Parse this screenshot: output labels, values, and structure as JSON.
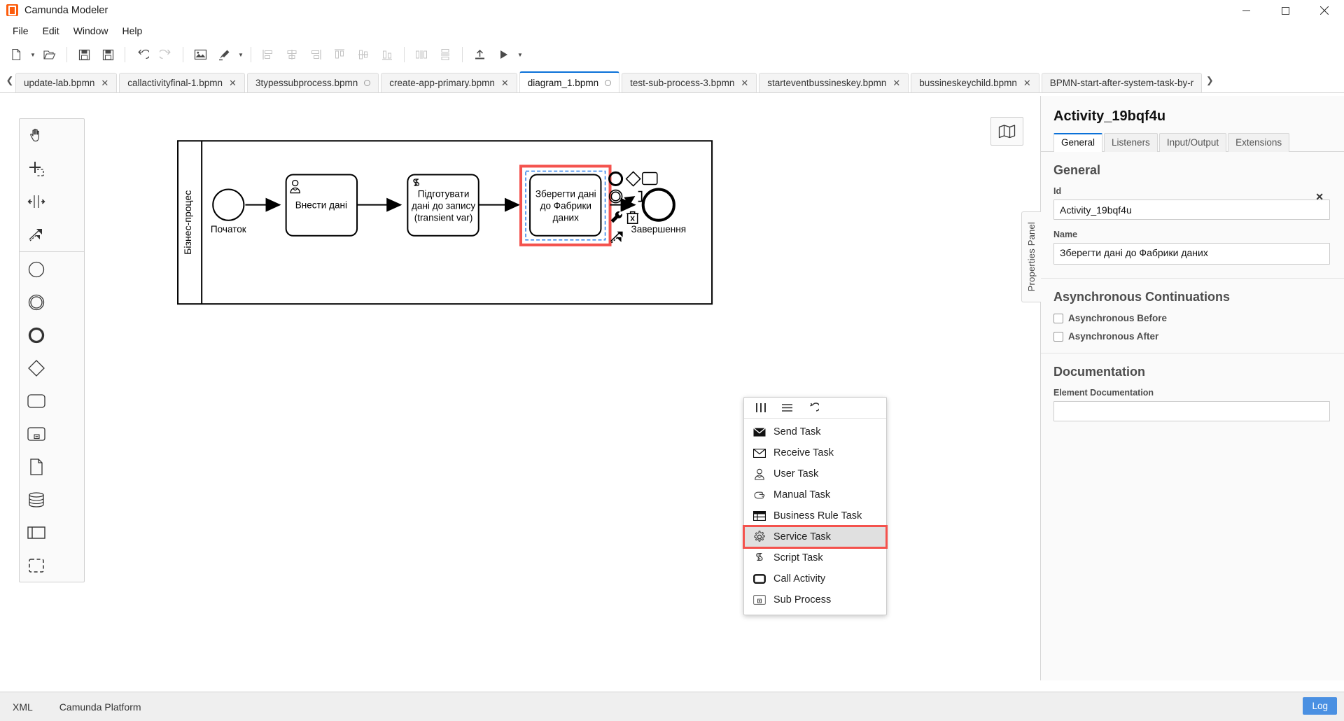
{
  "window": {
    "title": "Camunda Modeler",
    "logo_icon": "camunda-logo-icon",
    "minimize_label": "Minimize",
    "maximize_label": "Maximize",
    "close_label": "Close"
  },
  "menubar": {
    "items": [
      {
        "label": "File"
      },
      {
        "label": "Edit"
      },
      {
        "label": "Window"
      },
      {
        "label": "Help"
      }
    ]
  },
  "toolbar": {
    "buttons": [
      {
        "name": "new-file-button",
        "icon": "new-file-icon",
        "disabled": false,
        "caret": true
      },
      {
        "name": "open-file-button",
        "icon": "open-folder-icon",
        "disabled": false,
        "caret": false
      },
      {
        "name": "save-button",
        "icon": "save-icon",
        "disabled": false,
        "caret": false
      },
      {
        "name": "save-as-button",
        "icon": "save-as-icon",
        "disabled": false,
        "caret": false
      },
      {
        "name": "undo-button",
        "icon": "undo-icon",
        "disabled": false,
        "caret": false
      },
      {
        "name": "redo-button",
        "icon": "redo-icon",
        "disabled": true,
        "caret": false
      },
      {
        "name": "export-image-button",
        "icon": "image-icon",
        "disabled": false,
        "caret": false
      },
      {
        "name": "color-picker-button",
        "icon": "paintbrush-icon",
        "disabled": false,
        "caret": true
      },
      {
        "name": "align-left-button",
        "icon": "align-left-icon",
        "disabled": true,
        "caret": false
      },
      {
        "name": "align-center-button",
        "icon": "align-center-icon",
        "disabled": true,
        "caret": false
      },
      {
        "name": "align-right-button",
        "icon": "align-right-icon",
        "disabled": true,
        "caret": false
      },
      {
        "name": "align-top-button",
        "icon": "align-top-icon",
        "disabled": true,
        "caret": false
      },
      {
        "name": "align-middle-button",
        "icon": "align-middle-icon",
        "disabled": true,
        "caret": false
      },
      {
        "name": "align-bottom-button",
        "icon": "align-bottom-icon",
        "disabled": true,
        "caret": false
      },
      {
        "name": "distribute-horizontal-button",
        "icon": "distribute-horizontal-icon",
        "disabled": true,
        "caret": false
      },
      {
        "name": "distribute-vertical-button",
        "icon": "distribute-vertical-icon",
        "disabled": true,
        "caret": false
      },
      {
        "name": "deploy-button",
        "icon": "deploy-upload-icon",
        "disabled": false,
        "caret": false
      },
      {
        "name": "start-instance-button",
        "icon": "play-icon",
        "disabled": false,
        "caret": true
      }
    ]
  },
  "tabs": {
    "scroll_left_icon": "chevron-left-icon",
    "scroll_right_icon": "chevron-right-icon",
    "items": [
      {
        "label": "update-lab.bpmn",
        "active": false,
        "dirty": false
      },
      {
        "label": "callactivityfinal-1.bpmn",
        "active": false,
        "dirty": false
      },
      {
        "label": "3typessubprocess.bpmn",
        "active": false,
        "dirty": true
      },
      {
        "label": "create-app-primary.bpmn",
        "active": false,
        "dirty": false
      },
      {
        "label": "diagram_1.bpmn",
        "active": true,
        "dirty": true
      },
      {
        "label": "test-sub-process-3.bpmn",
        "active": false,
        "dirty": false
      },
      {
        "label": "starteventbussineskey.bpmn",
        "active": false,
        "dirty": false
      },
      {
        "label": "bussineskeychild.bpmn",
        "active": false,
        "dirty": false
      },
      {
        "label": "BPMN-start-after-system-task-by-r",
        "active": false,
        "dirty": false,
        "truncated": true
      }
    ]
  },
  "palette": {
    "tools": [
      {
        "name": "hand-tool",
        "icon": "hand-icon"
      },
      {
        "name": "lasso-tool",
        "icon": "lasso-select-icon"
      },
      {
        "name": "space-tool",
        "icon": "space-tool-icon"
      },
      {
        "name": "connect-tool",
        "icon": "connect-arrow-icon"
      }
    ],
    "elements": [
      {
        "name": "create-start-event",
        "icon": "start-event-circle-icon"
      },
      {
        "name": "create-intermediate-event",
        "icon": "intermediate-event-double-circle-icon"
      },
      {
        "name": "create-end-event",
        "icon": "end-event-thick-circle-icon"
      },
      {
        "name": "create-gateway",
        "icon": "gateway-diamond-icon"
      },
      {
        "name": "create-task",
        "icon": "task-rounded-rect-icon"
      },
      {
        "name": "create-expanded-subprocess",
        "icon": "subprocess-expanded-icon"
      },
      {
        "name": "create-data-object",
        "icon": "data-object-icon"
      },
      {
        "name": "create-data-store",
        "icon": "data-store-cylinder-icon"
      },
      {
        "name": "create-participant",
        "icon": "participant-pool-icon"
      },
      {
        "name": "create-group",
        "icon": "group-dashed-icon"
      }
    ]
  },
  "minimap": {
    "name": "toggle-minimap-button",
    "icon": "map-icon"
  },
  "diagram": {
    "pool_label": "Бізнес-процес",
    "start_event_label": "Початок",
    "end_event_label": "Завершення",
    "tasks": [
      {
        "id": "task-1",
        "label": "Внести дані",
        "type": "user-task",
        "marker_icon": "user-task-icon"
      },
      {
        "id": "task-2",
        "label": "Підготувати дані до запису (transient var)",
        "type": "script-task",
        "marker_icon": "script-task-icon",
        "lines": [
          "Підготувати",
          "дані до запису",
          "(transient var)"
        ]
      },
      {
        "id": "task-3",
        "label": "Зберегти дані до Фабрики даних",
        "type": "task",
        "selected": true,
        "lines": [
          "Зберегти дані",
          "до Фабрики",
          "даних"
        ]
      }
    ],
    "context_pad": {
      "items": [
        {
          "name": "append-end-event",
          "icon": "end-event-icon"
        },
        {
          "name": "append-gateway",
          "icon": "gateway-icon"
        },
        {
          "name": "append-task",
          "icon": "task-icon"
        },
        {
          "name": "append-intermediate-event",
          "icon": "intermediate-event-icon"
        },
        {
          "name": "append-text-annotation",
          "icon": "text-annotation-icon"
        },
        {
          "name": "change-type",
          "icon": "wrench-icon"
        },
        {
          "name": "delete-element",
          "icon": "trash-icon"
        },
        {
          "name": "connect",
          "icon": "connect-icon"
        }
      ]
    }
  },
  "replace_menu": {
    "header_icons": [
      {
        "name": "columns-view-icon",
        "glyph": "columns"
      },
      {
        "name": "list-view-icon",
        "glyph": "list"
      },
      {
        "name": "reset-icon",
        "glyph": "reset"
      }
    ],
    "items": [
      {
        "label": "Send Task",
        "icon": "send-task-envelope-filled-icon",
        "highlight": false
      },
      {
        "label": "Receive Task",
        "icon": "receive-task-envelope-outline-icon",
        "highlight": false
      },
      {
        "label": "User Task",
        "icon": "user-task-icon",
        "highlight": false
      },
      {
        "label": "Manual Task",
        "icon": "manual-task-hand-icon",
        "highlight": false
      },
      {
        "label": "Business Rule Task",
        "icon": "business-rule-table-icon",
        "highlight": false
      },
      {
        "label": "Service Task",
        "icon": "service-task-gear-icon",
        "highlight": true
      },
      {
        "label": "Script Task",
        "icon": "script-task-icon",
        "highlight": false
      },
      {
        "label": "Call Activity",
        "icon": "call-activity-icon",
        "highlight": false
      },
      {
        "label": "Sub Process",
        "icon": "sub-process-icon",
        "highlight": false
      }
    ]
  },
  "properties": {
    "handle_label": "Properties Panel",
    "element_title": "Activity_19bqf4u",
    "tabs": [
      {
        "label": "General",
        "active": true
      },
      {
        "label": "Listeners",
        "active": false
      },
      {
        "label": "Input/Output",
        "active": false
      },
      {
        "label": "Extensions",
        "active": false
      }
    ],
    "general": {
      "section_title": "General",
      "id_label": "Id",
      "id_value": "Activity_19bqf4u",
      "clear_icon": "clear-x-icon",
      "name_label": "Name",
      "name_value": "Зберегти дані до Фабрики даних"
    },
    "async": {
      "section_title": "Asynchronous Continuations",
      "before_label": "Asynchronous Before",
      "before_checked": false,
      "after_label": "Asynchronous After",
      "after_checked": false
    },
    "documentation": {
      "section_title": "Documentation",
      "field_label": "Element Documentation",
      "value": ""
    }
  },
  "statusbar": {
    "items": [
      {
        "label": "XML",
        "name": "xml-view-button"
      },
      {
        "label": "Camunda Platform",
        "name": "engine-profile-button"
      }
    ],
    "log_label": "Log",
    "accent_color": "#4a90e2"
  },
  "colors": {
    "accent": "#0b71d8",
    "brand_orange": "#fc5d0d",
    "selection_red": "#f4524d",
    "log_blue": "#4a90e2"
  }
}
